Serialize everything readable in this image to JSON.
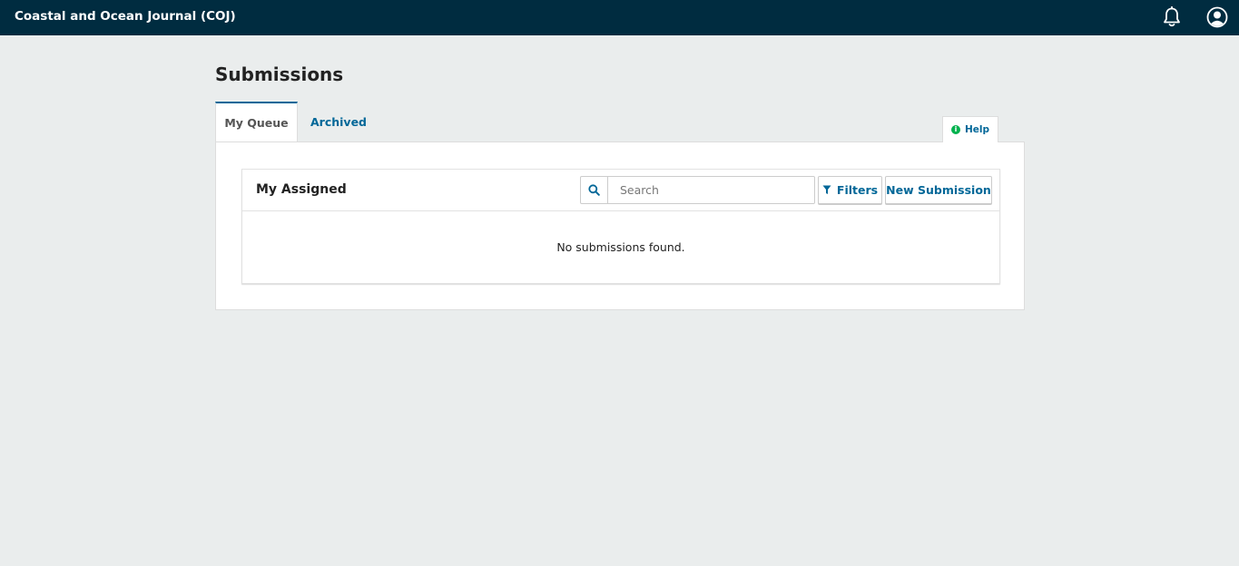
{
  "header": {
    "site_title": "Coastal and Ocean Journal (COJ)",
    "icons": [
      "bell-icon",
      "user-circle-icon"
    ]
  },
  "page": {
    "title": "Submissions"
  },
  "tabs": [
    {
      "label": "My Queue",
      "active": true
    },
    {
      "label": "Archived",
      "active": false
    }
  ],
  "help": {
    "label": "Help",
    "icon": "info-icon"
  },
  "list": {
    "title": "My Assigned",
    "search": {
      "placeholder": "Search",
      "value": ""
    },
    "filters_label": "Filters",
    "new_submission_label": "New Submission",
    "empty_message": "No submissions found."
  },
  "colors": {
    "header_bg": "#002c40",
    "page_bg": "#eaeded",
    "accent": "#006798",
    "help_green": "#00b24e"
  }
}
